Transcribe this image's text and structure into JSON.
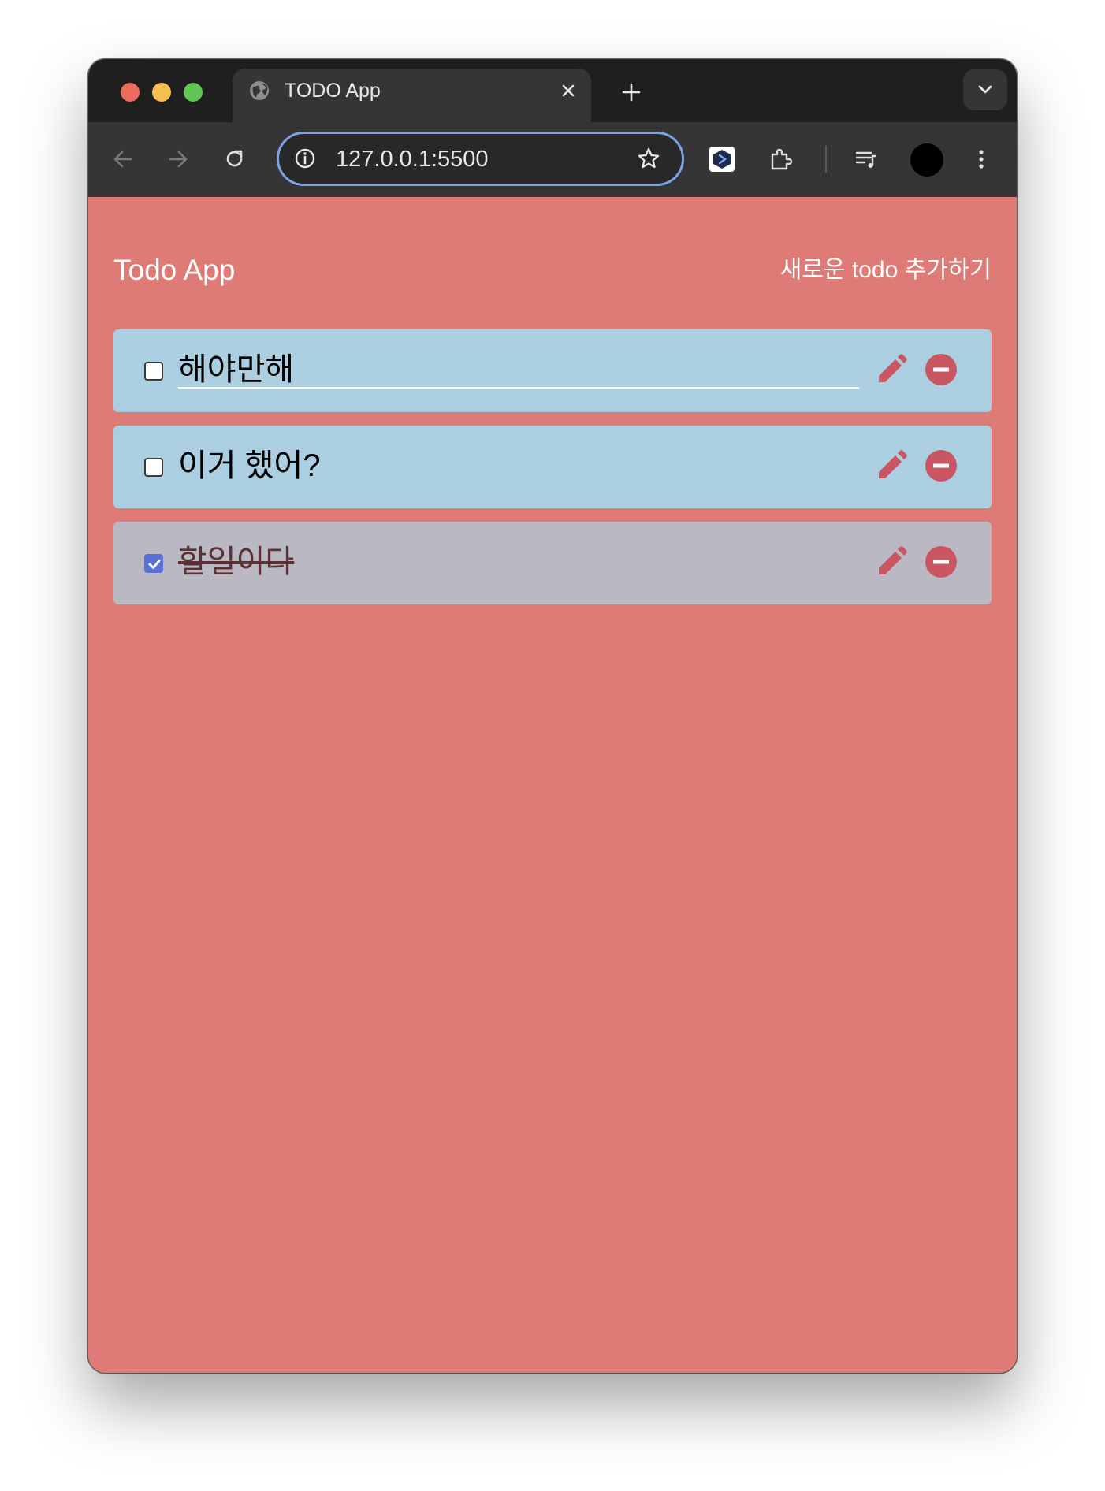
{
  "browser": {
    "tab_title": "TODO App",
    "url": "127.0.0.1:5500"
  },
  "header": {
    "title": "Todo App",
    "add_link": "새로운 todo 추가하기"
  },
  "todos": [
    {
      "text": "해야만해",
      "done": false,
      "editing": true
    },
    {
      "text": "이거 했어?",
      "done": false,
      "editing": false
    },
    {
      "text": "할일이다",
      "done": true,
      "editing": false
    }
  ],
  "colors": {
    "page_background": "#df7b76",
    "todo_background": "#abcfe0",
    "todo_done_background": "#bab8c3",
    "action_icon": "#c95763",
    "checkbox_checked": "#5a6fd8"
  },
  "icons": {
    "edit": "pencil-icon",
    "delete": "minus-circle-icon"
  }
}
